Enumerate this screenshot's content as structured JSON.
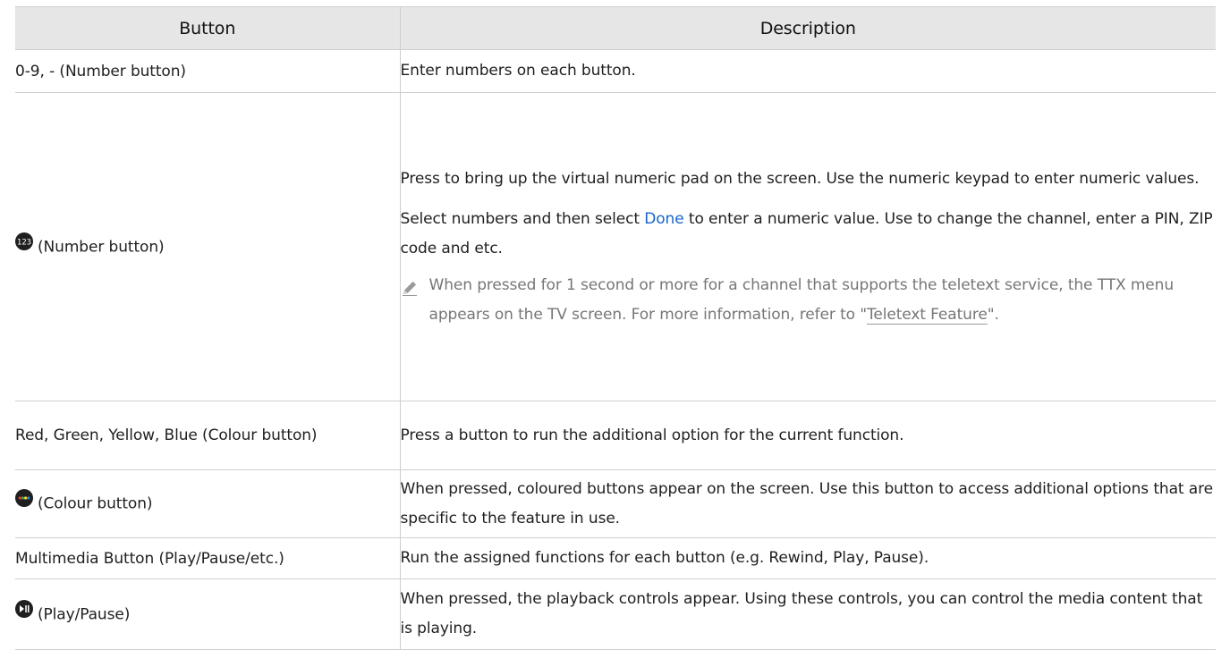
{
  "table": {
    "headers": [
      "Button",
      "Description"
    ],
    "rows": [
      {
        "button": "0-9, - (Number button)",
        "description": "Enter numbers on each button."
      },
      {
        "icon": "number-123-icon",
        "button": "(Number button)",
        "description_p1": "Press to bring up the virtual numeric pad on the screen. Use the numeric keypad to enter numeric values.",
        "description_p2_before": "Select numbers and then select ",
        "description_p2_highlight": "Done",
        "description_p2_after": " to enter a numeric value. Use to change the channel, enter a PIN, ZIP code and etc.",
        "note_icon": "pencil-note-icon",
        "note_before": "When pressed for 1 second or more for a channel that supports the teletext service, the TTX menu appears on the TV screen. For more information, refer to \"",
        "note_link": "Teletext Feature",
        "note_after": "\"."
      },
      {
        "button": "Red, Green, Yellow, Blue (Colour button)",
        "description": "Press a button to run the additional option for the current function."
      },
      {
        "icon": "colour-button-icon",
        "button": "(Colour button)",
        "description": "When pressed, coloured buttons appear on the screen. Use this button to access additional options that are specific to the feature in use."
      },
      {
        "button": "Multimedia Button (Play/Pause/etc.)",
        "description": "Run the assigned functions for each button (e.g. Rewind, Play, Pause)."
      },
      {
        "icon": "play-pause-icon",
        "button": "(Play/Pause)",
        "description": "When pressed, the playback controls appear. Using these controls, you can control the media content that is playing."
      }
    ]
  },
  "colors": {
    "header_bg": "#e6e6e6",
    "border": "#cfcfcf",
    "highlight": "#1766c9",
    "note_text": "#767676"
  }
}
